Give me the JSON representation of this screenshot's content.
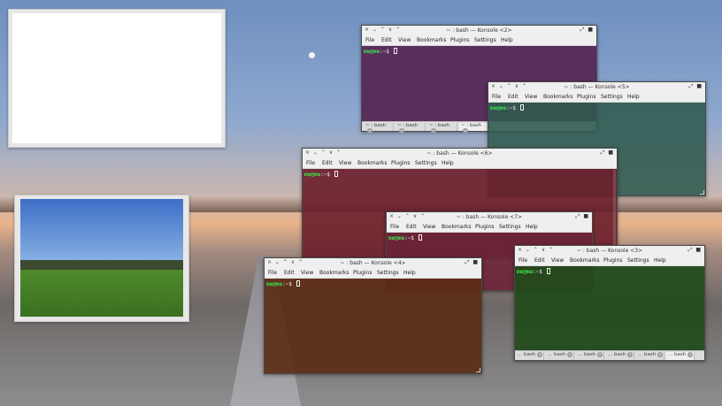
{
  "menu_items": [
    "File",
    "Edit",
    "View",
    "Bookmarks",
    "Plugins",
    "Settings",
    "Help"
  ],
  "prompt": {
    "user": "me@me",
    "path": ":~$"
  },
  "windows": [
    {
      "title": "~ : bash — Konsole <2>",
      "tabs": [
        "~ : bash",
        "~ : bash",
        "~ : bash",
        "~ : bash"
      ]
    },
    {
      "title": "~ : bash — Konsole <5>"
    },
    {
      "title": "~ : bash — Konsole <6>"
    },
    {
      "title": "~ : bash — Konsole <7>"
    },
    {
      "title": "~ : bash — Konsole <4>"
    },
    {
      "title": "~ : bash — Konsole <3>",
      "tabs": [
        "... bash",
        "... bash",
        "... bash",
        "... bash",
        "... bash",
        "... bash"
      ]
    }
  ],
  "titlebar_glyphs": {
    "left": "× ⌄ ⌃ ∨ ⌃",
    "right": "⤢ ■"
  },
  "colors": {
    "konsole2": "#5a2e5c",
    "konsole5": "#2f5a4e",
    "konsole6": "#6a1e2a",
    "konsole7": "#6a2437",
    "konsole4": "#5a2b14",
    "konsole3": "#1f4a1a"
  }
}
